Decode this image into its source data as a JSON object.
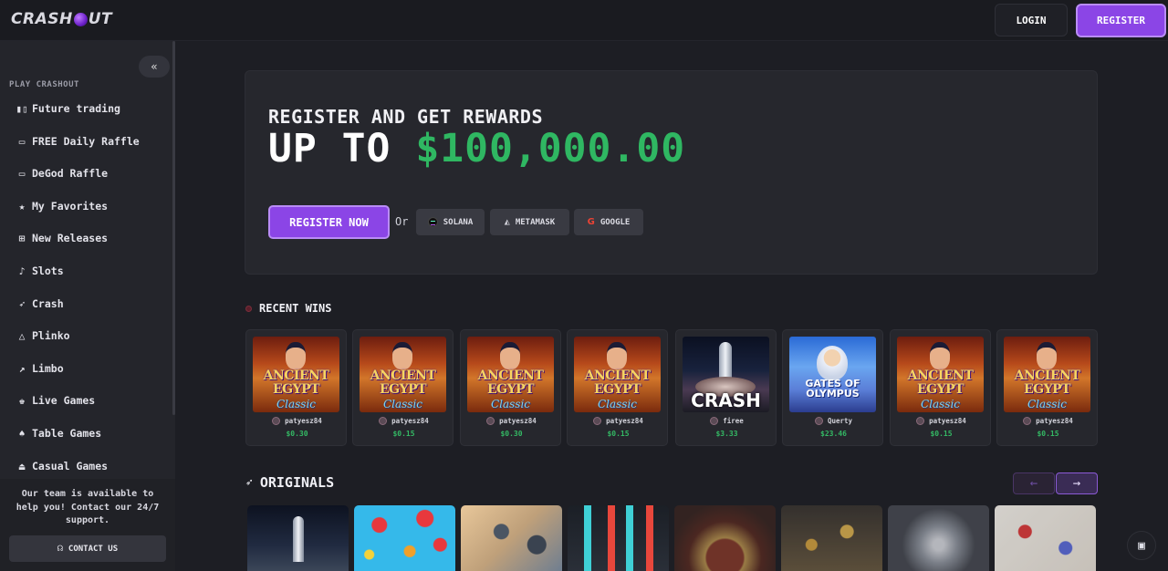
{
  "app": {
    "logo_text_a": "CRASH",
    "logo_text_b": "UT"
  },
  "header": {
    "login_label": "LOGIN",
    "register_label": "REGISTER"
  },
  "sidebar": {
    "collapse_glyph": "«",
    "heading": "PLAY CRASHOUT",
    "items": [
      {
        "label": "Future trading",
        "icon": "candlestick-icon"
      },
      {
        "label": "FREE Daily Raffle",
        "icon": "ticket-icon"
      },
      {
        "label": "DeGod Raffle",
        "icon": "ticket-icon"
      },
      {
        "label": "My Favorites",
        "icon": "star-icon"
      },
      {
        "label": "New Releases",
        "icon": "gift-icon"
      },
      {
        "label": "Slots",
        "icon": "cherry-icon"
      },
      {
        "label": "Crash",
        "icon": "rocket-icon"
      },
      {
        "label": "Plinko",
        "icon": "triangle-icon"
      },
      {
        "label": "Limbo",
        "icon": "line-chart-icon"
      },
      {
        "label": "Live Games",
        "icon": "chess-king-icon"
      },
      {
        "label": "Table Games",
        "icon": "cards-icon"
      },
      {
        "label": "Casual Games",
        "icon": "joystick-icon"
      }
    ],
    "support_text": "Our team is available to help you! Contact our 24/7 support.",
    "contact_label": "CONTACT US"
  },
  "hero": {
    "subtitle": "REGISTER AND GET REWARDS",
    "up_to": "UP TO",
    "amount": "$100,000.00",
    "register_label": "REGISTER NOW",
    "or_text": "Or",
    "wallets": [
      {
        "label": "SOLANA",
        "icon": "solana-icon"
      },
      {
        "label": "METAMASK",
        "icon": "metamask-icon"
      },
      {
        "label": "GOOGLE",
        "icon": "google-icon"
      }
    ]
  },
  "recent_wins": {
    "title": "RECENT WINS",
    "items": [
      {
        "game": "ancient-egypt",
        "line1": "ANCIENT",
        "line2": "EGYPT",
        "line3": "Classic",
        "user": "patyesz84",
        "amount": "$0.30"
      },
      {
        "game": "ancient-egypt",
        "line1": "ANCIENT",
        "line2": "EGYPT",
        "line3": "Classic",
        "user": "patyesz84",
        "amount": "$0.15"
      },
      {
        "game": "ancient-egypt",
        "line1": "ANCIENT",
        "line2": "EGYPT",
        "line3": "Classic",
        "user": "patyesz84",
        "amount": "$0.30"
      },
      {
        "game": "ancient-egypt",
        "line1": "ANCIENT",
        "line2": "EGYPT",
        "line3": "Classic",
        "user": "patyesz84",
        "amount": "$0.15"
      },
      {
        "game": "crash",
        "line1": "CRASH",
        "user": "firee",
        "amount": "$3.33"
      },
      {
        "game": "gates-of-olympus",
        "line1": "GATES OF",
        "line2": "OLYMPUS",
        "user": "Querty",
        "amount": "$23.46"
      },
      {
        "game": "ancient-egypt",
        "line1": "ANCIENT",
        "line2": "EGYPT",
        "line3": "Classic",
        "user": "patyesz84",
        "amount": "$0.15"
      },
      {
        "game": "ancient-egypt",
        "line1": "ANCIENT",
        "line2": "EGYPT",
        "line3": "Classic",
        "user": "patyesz84",
        "amount": "$0.15"
      }
    ]
  },
  "originals": {
    "title": "ORIGINALS",
    "prev_glyph": "←",
    "next_glyph": "→",
    "items": [
      "crash",
      "plinko",
      "mines",
      "trading",
      "wheel",
      "coins",
      "diamonds",
      "dice"
    ]
  },
  "chat": {
    "icon": "chat-icon"
  },
  "colors": {
    "accent": "#8b45e6",
    "accent_border": "#b98cf5",
    "money": "#2fb762",
    "bg": "#1d1e24"
  }
}
